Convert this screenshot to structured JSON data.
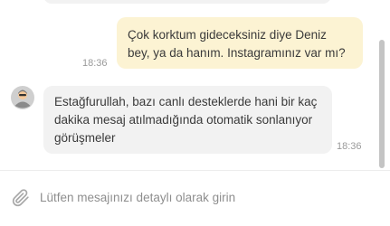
{
  "messages": [
    {
      "direction": "outgoing",
      "text": "Çok korktum gideceksiniz diye Deniz bey, ya da hanım. Instagramınız var mı?",
      "time": "18:36"
    },
    {
      "direction": "incoming",
      "text": "Estağfurullah, bazı canlı desteklerde hani bir kaç dakika mesaj atılmadığında otomatik sonlanıyor görüşmeler",
      "time": "18:36"
    }
  ],
  "composer": {
    "placeholder": "Lütfen mesajınızı detaylı olarak girin",
    "value": ""
  },
  "icons": {
    "attach": "paperclip-icon",
    "avatar": "support-agent-avatar"
  },
  "colors": {
    "outgoing_bubble": "#fcf3d3",
    "incoming_bubble": "#f2f2f2"
  }
}
